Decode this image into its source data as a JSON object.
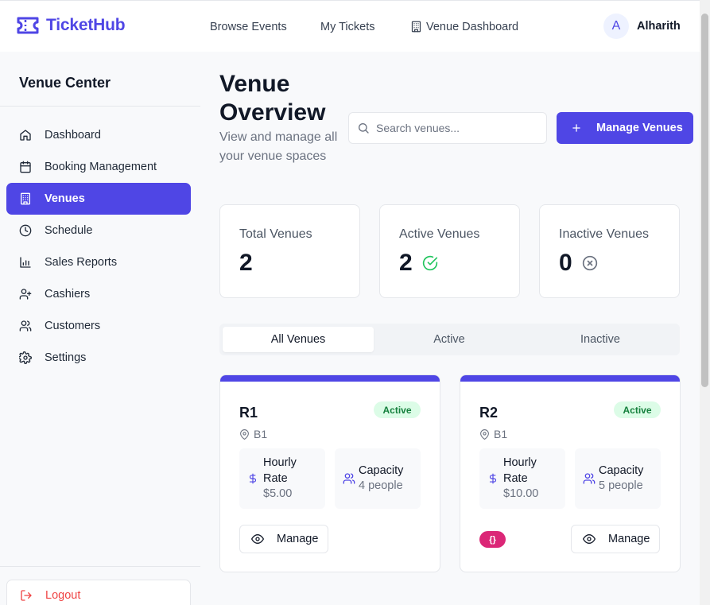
{
  "app": {
    "brand": "TicketHub",
    "brand_color": "#4f46e5"
  },
  "nav": {
    "browse": "Browse Events",
    "tickets": "My Tickets",
    "dashboard": "Venue Dashboard"
  },
  "user": {
    "initial": "A",
    "name": "Alharith"
  },
  "sidebar": {
    "title": "Venue Center",
    "items": [
      {
        "label": "Dashboard",
        "icon": "home-icon"
      },
      {
        "label": "Booking Management",
        "icon": "calendar-icon"
      },
      {
        "label": "Venues",
        "icon": "building-icon",
        "active": true
      },
      {
        "label": "Schedule",
        "icon": "clock-icon"
      },
      {
        "label": "Sales Reports",
        "icon": "bar-chart-icon"
      },
      {
        "label": "Cashiers",
        "icon": "user-plus-icon"
      },
      {
        "label": "Customers",
        "icon": "users-icon"
      },
      {
        "label": "Settings",
        "icon": "gear-icon"
      }
    ],
    "logout": "Logout"
  },
  "page": {
    "title": "Venue Overview",
    "subtitle": "View and manage all your venue spaces",
    "search_placeholder": "Search venues...",
    "manage_button": "Manage Venues"
  },
  "stats": [
    {
      "label": "Total Venues",
      "value": "2"
    },
    {
      "label": "Active Venues",
      "value": "2",
      "icon": "check-circle-icon"
    },
    {
      "label": "Inactive Venues",
      "value": "0",
      "icon": "x-circle-icon"
    }
  ],
  "tabs": [
    "All Venues",
    "Active",
    "Inactive"
  ],
  "active_tab": "All Venues",
  "venues": [
    {
      "name": "R1",
      "status": "Active",
      "location": "B1",
      "rate_label": "Hourly Rate",
      "rate": "$5.00",
      "capacity_label": "Capacity",
      "capacity": "4 people",
      "action": "Manage"
    },
    {
      "name": "R2",
      "status": "Active",
      "location": "B1",
      "rate_label": "Hourly Rate",
      "rate": "$10.00",
      "capacity_label": "Capacity",
      "capacity": "5 people",
      "action": "Manage",
      "badge": "{}"
    }
  ]
}
